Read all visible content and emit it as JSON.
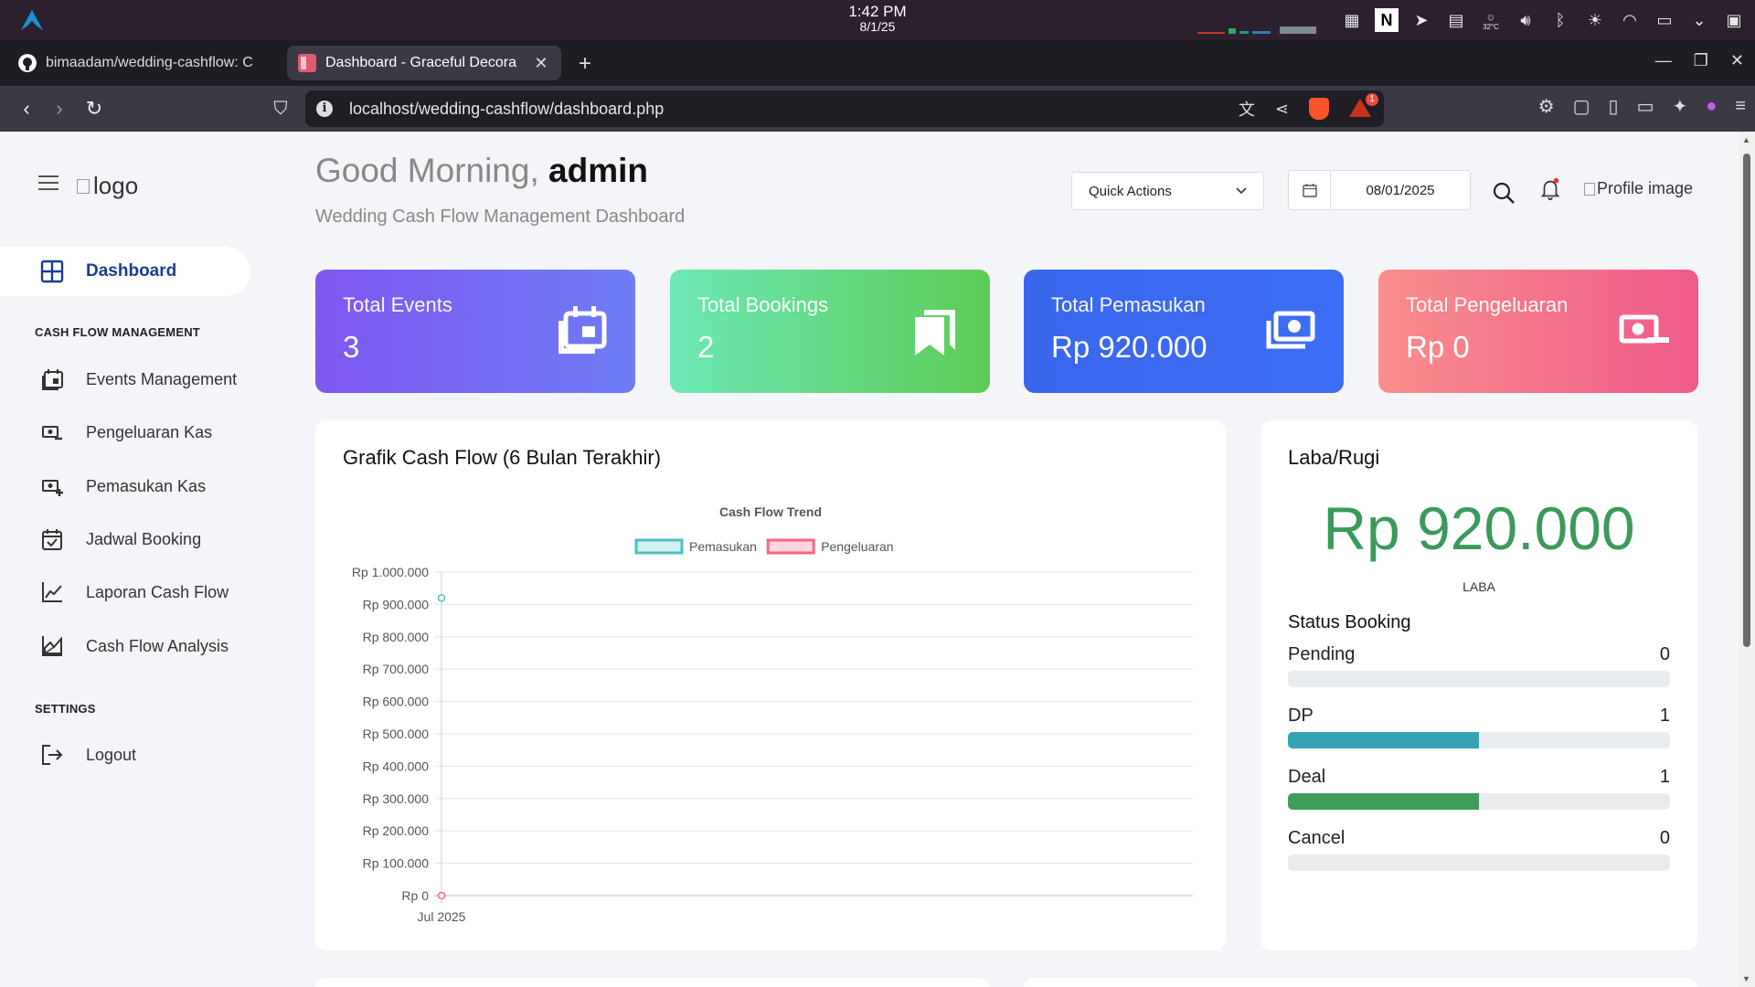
{
  "os": {
    "clock_time": "1:42 PM",
    "clock_date": "8/1/25",
    "temp": "32°C"
  },
  "browser": {
    "tabs": [
      {
        "title": "bimaadam/wedding-cashflow: C",
        "icon": "github-icon",
        "active": false
      },
      {
        "title": "Dashboard - Graceful Decora",
        "icon": "site-favicon",
        "active": true
      }
    ],
    "url": "localhost/wedding-cashflow/dashboard.php",
    "rewards_badge": "1"
  },
  "sidebar": {
    "logo_alt": "logo",
    "active_item": "Dashboard",
    "section_cashflow": "CASH FLOW MANAGEMENT",
    "items": [
      {
        "label": "Events Management",
        "icon": "calendar-event-icon"
      },
      {
        "label": "Pengeluaran Kas",
        "icon": "money-out-icon"
      },
      {
        "label": "Pemasukan Kas",
        "icon": "money-in-icon"
      },
      {
        "label": "Jadwal Booking",
        "icon": "calendar-check-icon"
      },
      {
        "label": "Laporan Cash Flow",
        "icon": "line-chart-icon"
      },
      {
        "label": "Cash Flow Analysis",
        "icon": "area-chart-icon"
      }
    ],
    "section_settings": "SETTINGS",
    "logout": "Logout"
  },
  "header": {
    "greeting": "Good Morning,",
    "user": "admin",
    "subtitle": "Wedding Cash Flow Management Dashboard",
    "quick_actions": "Quick Actions",
    "date": "08/01/2025",
    "profile_alt": "Profile image"
  },
  "stats": [
    {
      "title": "Total Events",
      "value": "3",
      "icon": "calendar-icon"
    },
    {
      "title": "Total Bookings",
      "value": "2",
      "icon": "bookmarks-icon"
    },
    {
      "title": "Total Pemasukan",
      "value": "Rp 920.000",
      "icon": "money-icon"
    },
    {
      "title": "Total Pengeluaran",
      "value": "Rp 0",
      "icon": "money-off-icon"
    }
  ],
  "chart_panel": {
    "title": "Grafik Cash Flow (6 Bulan Terakhir)"
  },
  "chart_data": {
    "type": "line",
    "title": "Cash Flow Trend",
    "categories": [
      "Jul 2025"
    ],
    "series": [
      {
        "name": "Pemasukan",
        "values": [
          920000
        ],
        "color": "#4bc0c0"
      },
      {
        "name": "Pengeluaran",
        "values": [
          0
        ],
        "color": "#ff6384"
      }
    ],
    "ylim": [
      0,
      1000000
    ],
    "yticks": [
      "Rp 0",
      "Rp 100.000",
      "Rp 200.000",
      "Rp 300.000",
      "Rp 400.000",
      "Rp 500.000",
      "Rp 600.000",
      "Rp 700.000",
      "Rp 800.000",
      "Rp 900.000",
      "Rp 1.000.000"
    ],
    "legend": "top",
    "grid": true
  },
  "labarugi": {
    "title": "Laba/Rugi",
    "amount": "Rp 920.000",
    "label": "LABA",
    "status_title": "Status Booking",
    "statuses": [
      {
        "label": "Pending",
        "count": "0",
        "fraction": 0,
        "color": "#17a2b8"
      },
      {
        "label": "DP",
        "count": "1",
        "fraction": 0.5,
        "color": "#35a3b5"
      },
      {
        "label": "Deal",
        "count": "1",
        "fraction": 0.5,
        "color": "#3f9d58"
      },
      {
        "label": "Cancel",
        "count": "0",
        "fraction": 0,
        "color": "#dc3545"
      }
    ]
  }
}
